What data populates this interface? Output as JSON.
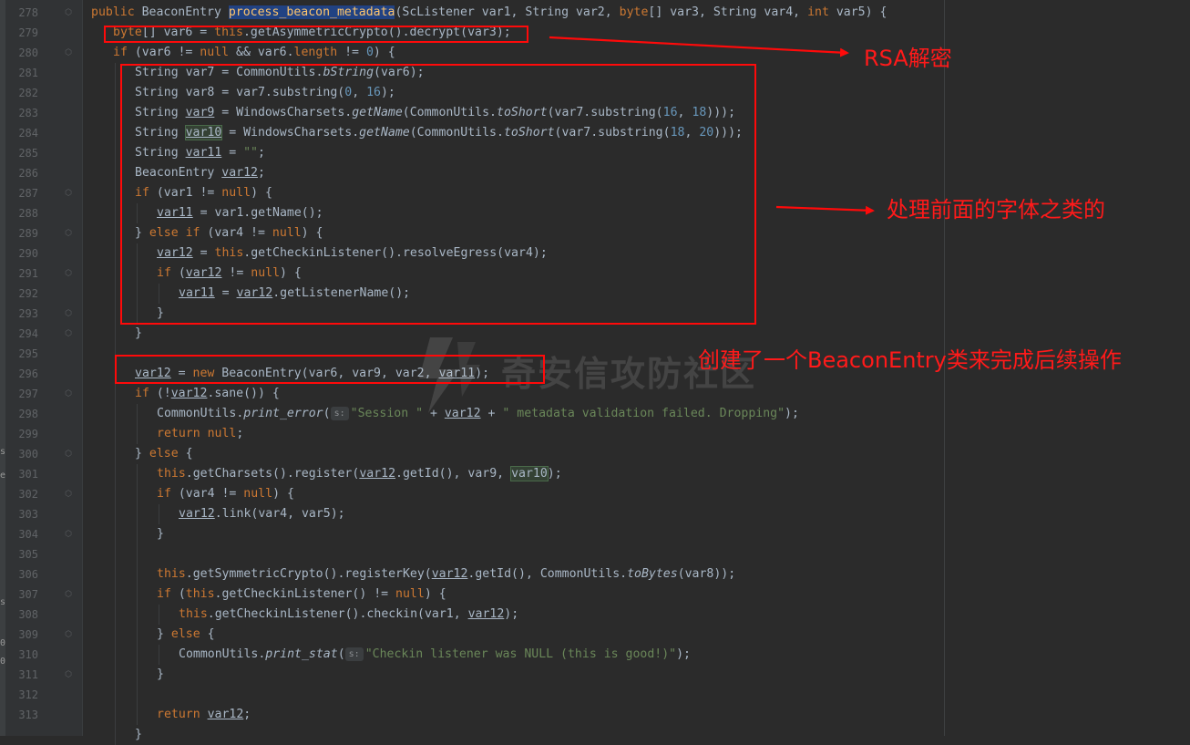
{
  "editor": {
    "lines": [
      {
        "num": "278",
        "indent": 0,
        "tokens": [
          [
            "kw",
            "public "
          ],
          [
            "",
            "BeaconEntry "
          ],
          [
            "fn hl-sel",
            "process_beacon_metadata"
          ],
          [
            "",
            "(ScListener var1, String var2, "
          ],
          [
            "kw",
            "byte"
          ],
          [
            "",
            "[] var3, String var4, "
          ],
          [
            "kw",
            "int"
          ],
          [
            "",
            " var5) {"
          ]
        ]
      },
      {
        "num": "279",
        "indent": 1,
        "tokens": [
          [
            "kw",
            "byte"
          ],
          [
            "",
            "[] var6 = "
          ],
          [
            "kw",
            "this"
          ],
          [
            "",
            ".getAsymmetricCrypto().decrypt(var3);"
          ]
        ]
      },
      {
        "num": "280",
        "indent": 1,
        "tokens": [
          [
            "kw",
            "if"
          ],
          [
            "",
            " (var6 != "
          ],
          [
            "kw",
            "null"
          ],
          [
            "",
            " && var6."
          ],
          [
            "kw",
            "length"
          ],
          [
            "",
            " != "
          ],
          [
            "num",
            "0"
          ],
          [
            "",
            ") {"
          ]
        ]
      },
      {
        "num": "281",
        "indent": 2,
        "tokens": [
          [
            "",
            "String var7 = CommonUtils."
          ],
          [
            "it",
            "bString"
          ],
          [
            "",
            "(var6);"
          ]
        ]
      },
      {
        "num": "282",
        "indent": 2,
        "tokens": [
          [
            "",
            "String var8 = var7.substring("
          ],
          [
            "num",
            "0"
          ],
          [
            "",
            ", "
          ],
          [
            "num",
            "16"
          ],
          [
            "",
            ");"
          ]
        ]
      },
      {
        "num": "283",
        "indent": 2,
        "tokens": [
          [
            "",
            "String "
          ],
          [
            "ul",
            "var9"
          ],
          [
            "",
            " = WindowsCharsets."
          ],
          [
            "it",
            "getName"
          ],
          [
            "",
            "(CommonUtils."
          ],
          [
            "it",
            "toShort"
          ],
          [
            "",
            "(var7.substring("
          ],
          [
            "num",
            "16"
          ],
          [
            "",
            ", "
          ],
          [
            "num",
            "18"
          ],
          [
            "",
            ")));"
          ]
        ]
      },
      {
        "num": "284",
        "indent": 2,
        "tokens": [
          [
            "",
            "String "
          ],
          [
            "hl-green ul",
            "var10"
          ],
          [
            "",
            " = WindowsCharsets."
          ],
          [
            "it",
            "getName"
          ],
          [
            "",
            "(CommonUtils."
          ],
          [
            "it",
            "toShort"
          ],
          [
            "",
            "(var7.substring("
          ],
          [
            "num",
            "18"
          ],
          [
            "",
            ", "
          ],
          [
            "num",
            "20"
          ],
          [
            "",
            ")));"
          ]
        ]
      },
      {
        "num": "285",
        "indent": 2,
        "tokens": [
          [
            "",
            "String "
          ],
          [
            "ul",
            "var11"
          ],
          [
            "",
            " = "
          ],
          [
            "str",
            "\"\""
          ],
          [
            "",
            ";"
          ]
        ]
      },
      {
        "num": "286",
        "indent": 2,
        "tokens": [
          [
            "",
            "BeaconEntry "
          ],
          [
            "ul",
            "var12"
          ],
          [
            "",
            ";"
          ]
        ]
      },
      {
        "num": "287",
        "indent": 2,
        "tokens": [
          [
            "kw",
            "if"
          ],
          [
            "",
            " (var1 != "
          ],
          [
            "kw",
            "null"
          ],
          [
            "",
            ") {"
          ]
        ]
      },
      {
        "num": "288",
        "indent": 3,
        "tokens": [
          [
            "ul",
            "var11"
          ],
          [
            "",
            " = var1.getName();"
          ]
        ]
      },
      {
        "num": "289",
        "indent": 2,
        "tokens": [
          [
            "",
            "} "
          ],
          [
            "kw",
            "else if"
          ],
          [
            "",
            " (var4 != "
          ],
          [
            "kw",
            "null"
          ],
          [
            "",
            ") {"
          ]
        ]
      },
      {
        "num": "290",
        "indent": 3,
        "tokens": [
          [
            "ul",
            "var12"
          ],
          [
            "",
            " = "
          ],
          [
            "kw",
            "this"
          ],
          [
            "",
            ".getCheckinListener().resolveEgress(var4);"
          ]
        ]
      },
      {
        "num": "291",
        "indent": 3,
        "tokens": [
          [
            "kw",
            "if"
          ],
          [
            "",
            " ("
          ],
          [
            "ul",
            "var12"
          ],
          [
            "",
            " != "
          ],
          [
            "kw",
            "null"
          ],
          [
            "",
            ") {"
          ]
        ]
      },
      {
        "num": "292",
        "indent": 4,
        "tokens": [
          [
            "ul",
            "var11"
          ],
          [
            "",
            " = "
          ],
          [
            "ul",
            "var12"
          ],
          [
            "",
            ".getListenerName();"
          ]
        ]
      },
      {
        "num": "293",
        "indent": 3,
        "tokens": [
          [
            "",
            "}"
          ]
        ]
      },
      {
        "num": "294",
        "indent": 2,
        "tokens": [
          [
            "",
            "}"
          ]
        ]
      },
      {
        "num": "295",
        "indent": 2,
        "tokens": []
      },
      {
        "num": "296",
        "indent": 2,
        "tokens": [
          [
            "ul",
            "var12"
          ],
          [
            "",
            " = "
          ],
          [
            "kw",
            "new "
          ],
          [
            "",
            "BeaconEntry(var6, var9, var2, "
          ],
          [
            "ul",
            "var11"
          ],
          [
            "",
            ");"
          ]
        ]
      },
      {
        "num": "297",
        "indent": 2,
        "tokens": [
          [
            "kw",
            "if"
          ],
          [
            "",
            " (!"
          ],
          [
            "ul",
            "var12"
          ],
          [
            "",
            ".sane()) {"
          ]
        ]
      },
      {
        "num": "298",
        "indent": 3,
        "tokens": [
          [
            "",
            "CommonUtils."
          ],
          [
            "it",
            "print_error"
          ],
          [
            "",
            "("
          ],
          [
            "hint",
            "s:"
          ],
          [
            "str",
            "\"Session \""
          ],
          [
            "",
            " + "
          ],
          [
            "ul",
            "var12"
          ],
          [
            "",
            " + "
          ],
          [
            "str",
            "\" metadata validation failed. Dropping\""
          ],
          [
            "",
            ");"
          ]
        ]
      },
      {
        "num": "299",
        "indent": 3,
        "tokens": [
          [
            "kw",
            "return null"
          ],
          [
            "",
            ";"
          ]
        ]
      },
      {
        "num": "300",
        "indent": 2,
        "tokens": [
          [
            "",
            "} "
          ],
          [
            "kw",
            "else"
          ],
          [
            "",
            " {"
          ]
        ]
      },
      {
        "num": "301",
        "indent": 3,
        "tokens": [
          [
            "kw",
            "this"
          ],
          [
            "",
            ".getCharsets().register("
          ],
          [
            "ul",
            "var12"
          ],
          [
            "",
            ".getId(), var9, "
          ],
          [
            "hl-green",
            "var10"
          ],
          [
            "",
            ");"
          ]
        ]
      },
      {
        "num": "302",
        "indent": 3,
        "tokens": [
          [
            "kw",
            "if"
          ],
          [
            "",
            " (var4 != "
          ],
          [
            "kw",
            "null"
          ],
          [
            "",
            ") {"
          ]
        ]
      },
      {
        "num": "303",
        "indent": 4,
        "tokens": [
          [
            "ul",
            "var12"
          ],
          [
            "",
            ".link(var4, var5);"
          ]
        ]
      },
      {
        "num": "304",
        "indent": 3,
        "tokens": [
          [
            "",
            "}"
          ]
        ]
      },
      {
        "num": "305",
        "indent": 3,
        "tokens": []
      },
      {
        "num": "306",
        "indent": 3,
        "tokens": [
          [
            "kw",
            "this"
          ],
          [
            "",
            ".getSymmetricCrypto().registerKey("
          ],
          [
            "ul",
            "var12"
          ],
          [
            "",
            ".getId(), CommonUtils."
          ],
          [
            "it",
            "toBytes"
          ],
          [
            "",
            "(var8));"
          ]
        ]
      },
      {
        "num": "307",
        "indent": 3,
        "tokens": [
          [
            "kw",
            "if"
          ],
          [
            "",
            " ("
          ],
          [
            "kw",
            "this"
          ],
          [
            "",
            ".getCheckinListener() != "
          ],
          [
            "kw",
            "null"
          ],
          [
            "",
            ") {"
          ]
        ]
      },
      {
        "num": "308",
        "indent": 4,
        "tokens": [
          [
            "kw",
            "this"
          ],
          [
            "",
            ".getCheckinListener().checkin(var1, "
          ],
          [
            "ul",
            "var12"
          ],
          [
            "",
            ");"
          ]
        ]
      },
      {
        "num": "309",
        "indent": 3,
        "tokens": [
          [
            "",
            "} "
          ],
          [
            "kw",
            "else"
          ],
          [
            "",
            " {"
          ]
        ]
      },
      {
        "num": "310",
        "indent": 4,
        "tokens": [
          [
            "",
            "CommonUtils."
          ],
          [
            "it",
            "print_stat"
          ],
          [
            "",
            "("
          ],
          [
            "hint",
            "s:"
          ],
          [
            "str",
            "\"Checkin listener was NULL (this is good!)\""
          ],
          [
            "",
            ");"
          ]
        ]
      },
      {
        "num": "311",
        "indent": 3,
        "tokens": [
          [
            "",
            "}"
          ]
        ]
      },
      {
        "num": "312",
        "indent": 3,
        "tokens": []
      },
      {
        "num": "313",
        "indent": 3,
        "tokens": [
          [
            "kw",
            "return "
          ],
          [
            "ul",
            "var12"
          ],
          [
            "",
            ";"
          ]
        ]
      },
      {
        "num": "",
        "indent": 2,
        "tokens": [
          [
            "",
            "}"
          ]
        ]
      }
    ]
  },
  "annotations": {
    "rsa": "RSA解密",
    "charset": "处理前面的字体之类的",
    "beacon_entry": "创建了一个BeaconEntry类来完成后续操作"
  },
  "watermark": {
    "text": "奇安信攻防社区"
  },
  "left_strip": [
    "s",
    "e",
    "s",
    "0",
    "0"
  ],
  "colors": {
    "annotation_red": "#ff1a1a",
    "editor_bg": "#2b2b2b",
    "keyword": "#cc7832",
    "method": "#ffc66d",
    "number": "#6897bb",
    "string": "#6a8759",
    "default_text": "#a9b7c6"
  }
}
